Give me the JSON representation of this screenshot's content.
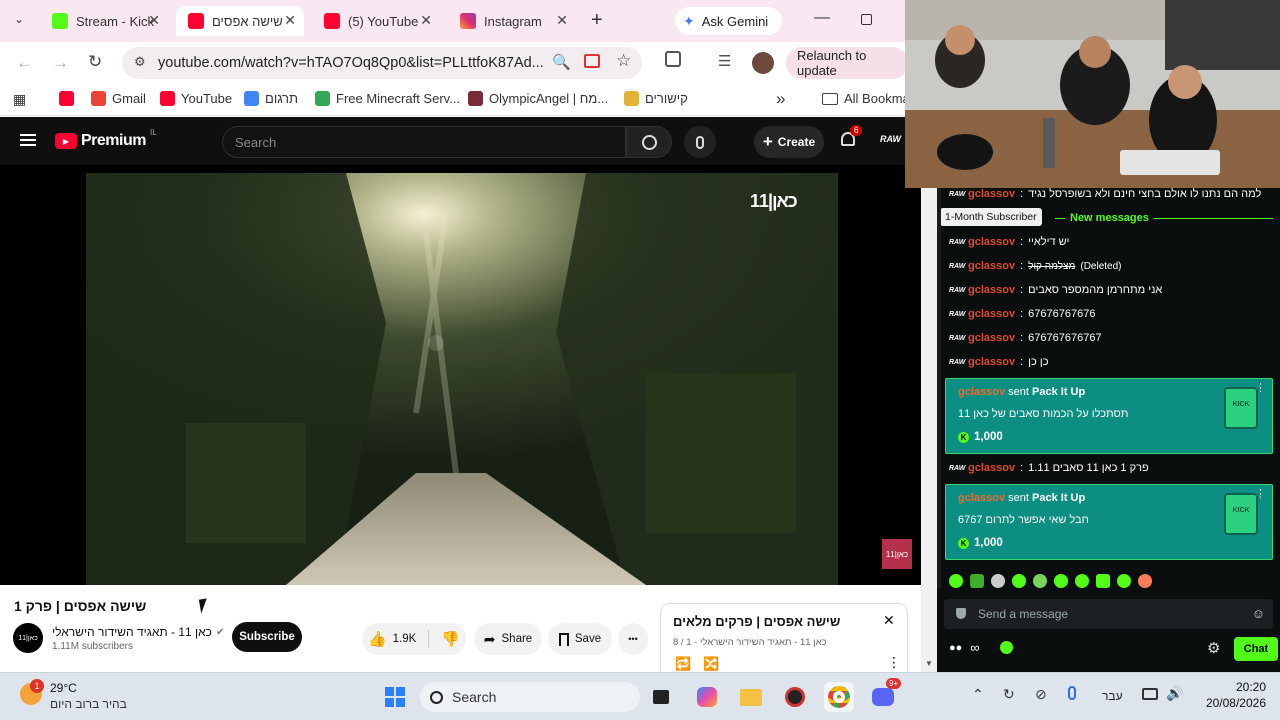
{
  "browser": {
    "tabs": [
      {
        "title": "Stream - Kick",
        "color": "#53fc18"
      },
      {
        "title": "שישה אפסים",
        "color": "#ff0033"
      },
      {
        "title": "(5) YouTube",
        "color": "#ff0033"
      },
      {
        "title": "Instagram",
        "color": "#e1306c"
      }
    ],
    "new_tab": "+",
    "gemini_label": "Ask Gemini",
    "url": "youtube.com/watch?v=hTAO7Oq8Qp0&list=PLLttfoK87Ad...",
    "relaunch_label": "Relaunch to update",
    "bookmarks": [
      {
        "label": "",
        "color": "#ff0033"
      },
      {
        "label": "Gmail",
        "color": "#ea4335"
      },
      {
        "label": "YouTube",
        "color": "#ff0033"
      },
      {
        "label": "תרגום",
        "color": "#4285f4"
      },
      {
        "label": "Free Minecraft Serv...",
        "color": "#34a853"
      },
      {
        "label": "OlympicAngel | מח...",
        "color": "#7a2b3a"
      },
      {
        "label": "קישורים",
        "color": "#e2b13c"
      }
    ],
    "bookmarks_more": "»",
    "all_bookmarks": "All Bookma"
  },
  "youtube": {
    "logo_text": "Premium",
    "logo_sup": "IL",
    "search_placeholder": "Search",
    "create_label": "Create",
    "notif_count": "6",
    "avatar_text": "RAW",
    "video_watermark": "כאן|11",
    "video_corner_logo": "כאן|11",
    "video_title": "שישה אפסים | פרק 1",
    "channel_name": "כאן 11 - תאגיד השידור הישראלי",
    "channel_avatar": "כאן|11",
    "subscribers": "1.11M subscribers",
    "subscribe_label": "Subscribe",
    "likes": "1.9K",
    "share_label": "Share",
    "save_label": "Save",
    "more_label": "•••",
    "playlist_title": "שישה אפסים | פרקים מלאים",
    "playlist_meta": "כאן 11 - תאגיד השידור הישראלי - 1 / 8",
    "playlist_close": "✕"
  },
  "chat": {
    "top_message": {
      "user": "gclassov",
      "text": "למה הם נתנו לו אולם בחצי חינם ולא בשופרסל נגיד"
    },
    "tooltip": "1-Month Subscriber",
    "new_messages": "New messages",
    "messages": [
      {
        "user": "gclassov",
        "text": "יש דילאיי"
      },
      {
        "user": "gclassov",
        "text": "מצלמה קול",
        "note": "(Deleted)"
      },
      {
        "user": "gclassov",
        "text": "אני מתחרמן מהמספר סאבים"
      },
      {
        "user": "gclassov",
        "text": "67676767676"
      },
      {
        "user": "gclassov",
        "text": "676767676767"
      },
      {
        "user": "gclassov",
        "text": "כן כן"
      }
    ],
    "gift1": {
      "user": "gclassov",
      "action": "sent",
      "item": "Pack It Up",
      "text": "תסתכלו על הכמות סאבים של כאן 11",
      "amount": "1,000"
    },
    "mid_message": {
      "user": "gclassov",
      "text": "פרק 1 כאן 11 סאבים 1.11"
    },
    "gift2": {
      "user": "gclassov",
      "action": "sent",
      "item": "Pack It Up",
      "text": "חבל שאי אפשר לתרום 6767",
      "amount": "1,000"
    },
    "badge_text": "RAW",
    "input_placeholder": "Send a message",
    "chat_button": "Chat",
    "infinity": "∞"
  },
  "taskbar": {
    "weather_temp": "29°C",
    "weather_desc": "בהיר ברוב היום",
    "weather_badge": "1",
    "search_label": "Search",
    "lang": "עבר",
    "time": "20:20",
    "date": "20/08/2026",
    "discord_badge": "9+"
  }
}
